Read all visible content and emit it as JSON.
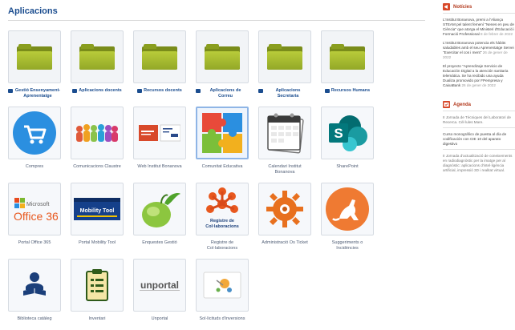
{
  "page": {
    "title": "Aplicacions"
  },
  "colors": {
    "title": "#1b4d8f",
    "accent": "#b33a1e",
    "folder": "#a3b830"
  },
  "tiles": [
    {
      "label": "Gestió Ensenyament-Aprenentatge",
      "icon": "folder-icon"
    },
    {
      "label": "Aplicacions docents",
      "icon": "folder-icon"
    },
    {
      "label": "Recursos docents",
      "icon": "folder-icon"
    },
    {
      "label": "Aplicacions de Correu",
      "icon": "folder-icon"
    },
    {
      "label": "Aplicacions Secretaria",
      "icon": "folder-icon"
    },
    {
      "label": "Recursos Humans",
      "icon": "folder-icon"
    },
    {
      "label": "Compres",
      "icon": "shopping-cart-icon"
    },
    {
      "label": "Comunicacions Claustre",
      "icon": "people-group-icon"
    },
    {
      "label": "Web Institut Bonanova",
      "icon": "institut-bonanova-logo-icon"
    },
    {
      "label": "Comunitat Educativa",
      "icon": "puzzle-icon"
    },
    {
      "label": "Calendari Institut Bonanova",
      "icon": "calendar-icon"
    },
    {
      "label": "SharePoint",
      "icon": "sharepoint-icon"
    },
    {
      "label": "Portal Office 365",
      "icon": "office365-icon"
    },
    {
      "label": "Portal Mobility Tool",
      "icon": "mobility-tool-icon"
    },
    {
      "label": "Enquestes Gestió",
      "icon": "lime-survey-icon"
    },
    {
      "label": "Registre de Col·laboracions",
      "icon": "collaborations-icon"
    },
    {
      "label": "Administració Os Ticket",
      "icon": "gear-ticket-icon"
    },
    {
      "label": "Suggeriments o Incidències",
      "icon": "kangaroo-icon"
    },
    {
      "label": "Biblioteca catàleg",
      "icon": "library-reader-icon"
    },
    {
      "label": "Inventari",
      "icon": "clipboard-icon"
    },
    {
      "label": "Unportal",
      "icon": "unportal-icon"
    },
    {
      "label": "Sol·licituds d'inversions",
      "icon": "requests-icon"
    }
  ],
  "sidebar": {
    "news_title": "Notícies",
    "news": [
      {
        "text": "L'Institut Bonanova, premi a l'Aliança STEAM pel talent femení \"Nenes en peu de Ciència\" que atorga el Ministeri d'Educació i Formació Professional",
        "date": "8 de febrer de 2022"
      },
      {
        "text": "L'Institut Bonanova potencia els hàbits saludables amb el seu Aprenentatge Servei \"Exercitar el cos i ment\"",
        "date": "26 de gener de 2022"
      },
      {
        "text": "El proyecto \"Aprendizaje Servicio de Educación Digital a la atención sanitaria telemática. Se ha recibido una ayuda Dualiza promovido por FPempresa y CaixaBank",
        "date": "26 de gener de 2022"
      }
    ],
    "agenda_title": "Agenda",
    "agenda": [
      {
        "text": "II Jornada de Tècniques del Laboratori de Recerca. Cèl·lules Mare.",
        "date": ""
      },
      {
        "text": "Curso monográfico de puesta al día de codificación con CIE 10 del aparato digestivo",
        "date": ""
      },
      {
        "text": "II Jornada d'actualització de coneixements en radiodiagnòstic per la imatge per al diagnòstic: aplicacions d'intel·ligència artificial, impressió 3D i realitat virtual.",
        "date": ""
      }
    ]
  }
}
